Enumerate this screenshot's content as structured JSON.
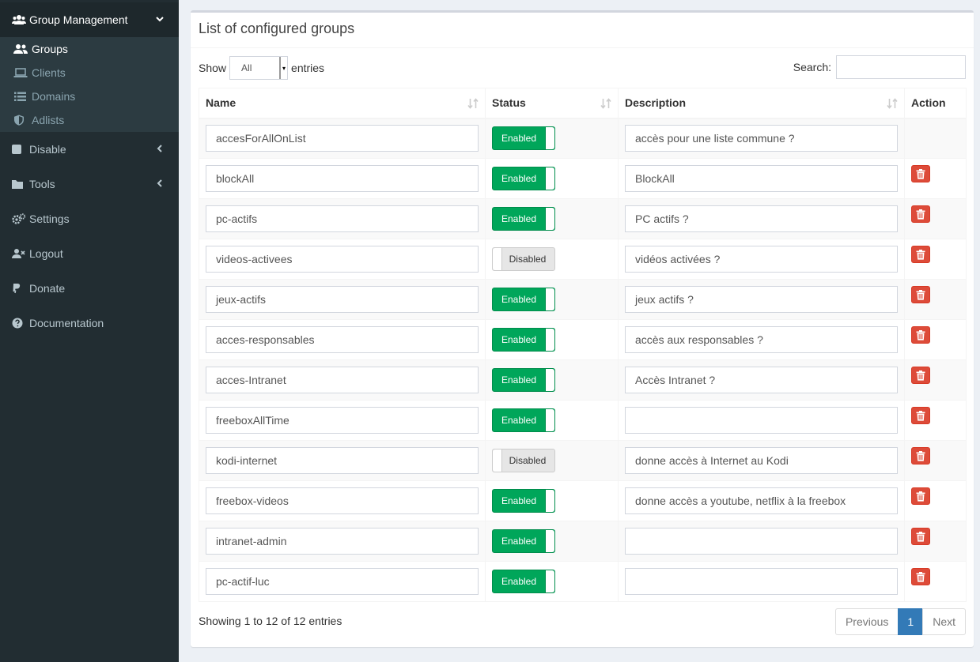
{
  "sidebar": {
    "group_menu": {
      "label": "Group Management",
      "icon": "users-icon"
    },
    "submenu": [
      {
        "label": "Groups",
        "icon": "user-group-icon",
        "active": true
      },
      {
        "label": "Clients",
        "icon": "laptop-icon",
        "active": false
      },
      {
        "label": "Domains",
        "icon": "list-icon",
        "active": false
      },
      {
        "label": "Adlists",
        "icon": "shield-icon",
        "active": false
      }
    ],
    "items": [
      {
        "label": "Disable",
        "icon": "stop-icon",
        "chevron": true
      },
      {
        "label": "Tools",
        "icon": "folder-icon",
        "chevron": true
      },
      {
        "label": "Settings",
        "icon": "gears-icon",
        "chevron": false
      },
      {
        "label": "Logout",
        "icon": "user-times-icon",
        "chevron": false
      },
      {
        "label": "Donate",
        "icon": "paypal-icon",
        "chevron": false
      },
      {
        "label": "Documentation",
        "icon": "question-circle-icon",
        "chevron": false
      }
    ]
  },
  "box": {
    "title": "List of configured groups",
    "show_label": "Show",
    "entries_label": "entries",
    "length_value": "All",
    "search_label": "Search:",
    "search_value": ""
  },
  "table": {
    "headers": {
      "name": "Name",
      "status": "Status",
      "description": "Description",
      "action": "Action"
    },
    "rows": [
      {
        "name": "accesForAllOnList",
        "status": "Enabled",
        "description": "accès pour une liste commune ?",
        "deletable": false
      },
      {
        "name": "blockAll",
        "status": "Enabled",
        "description": "BlockAll",
        "deletable": true
      },
      {
        "name": "pc-actifs",
        "status": "Enabled",
        "description": "PC actifs ?",
        "deletable": true
      },
      {
        "name": "videos-activees",
        "status": "Disabled",
        "description": "vidéos activées ?",
        "deletable": true
      },
      {
        "name": "jeux-actifs",
        "status": "Enabled",
        "description": "jeux actifs ?",
        "deletable": true
      },
      {
        "name": "acces-responsables",
        "status": "Enabled",
        "description": "accès aux responsables ?",
        "deletable": true
      },
      {
        "name": "acces-Intranet",
        "status": "Enabled",
        "description": "Accès Intranet ?",
        "deletable": true
      },
      {
        "name": "freeboxAllTime",
        "status": "Enabled",
        "description": "",
        "deletable": true
      },
      {
        "name": "kodi-internet",
        "status": "Disabled",
        "description": "donne accès à Internet au Kodi",
        "deletable": true
      },
      {
        "name": "freebox-videos",
        "status": "Enabled",
        "description": "donne accès a youtube, netflix à la freebox",
        "deletable": true
      },
      {
        "name": "intranet-admin",
        "status": "Enabled",
        "description": "",
        "deletable": true
      },
      {
        "name": "pc-actif-luc",
        "status": "Enabled",
        "description": "",
        "deletable": true
      }
    ]
  },
  "footer": {
    "info": "Showing 1 to 12 of 12 entries",
    "previous": "Previous",
    "page": "1",
    "next": "Next"
  },
  "colors": {
    "sidebar_bg": "#222d32",
    "enabled_green": "#00a65a",
    "delete_red": "#dd4b39",
    "pager_active": "#337ab7"
  }
}
